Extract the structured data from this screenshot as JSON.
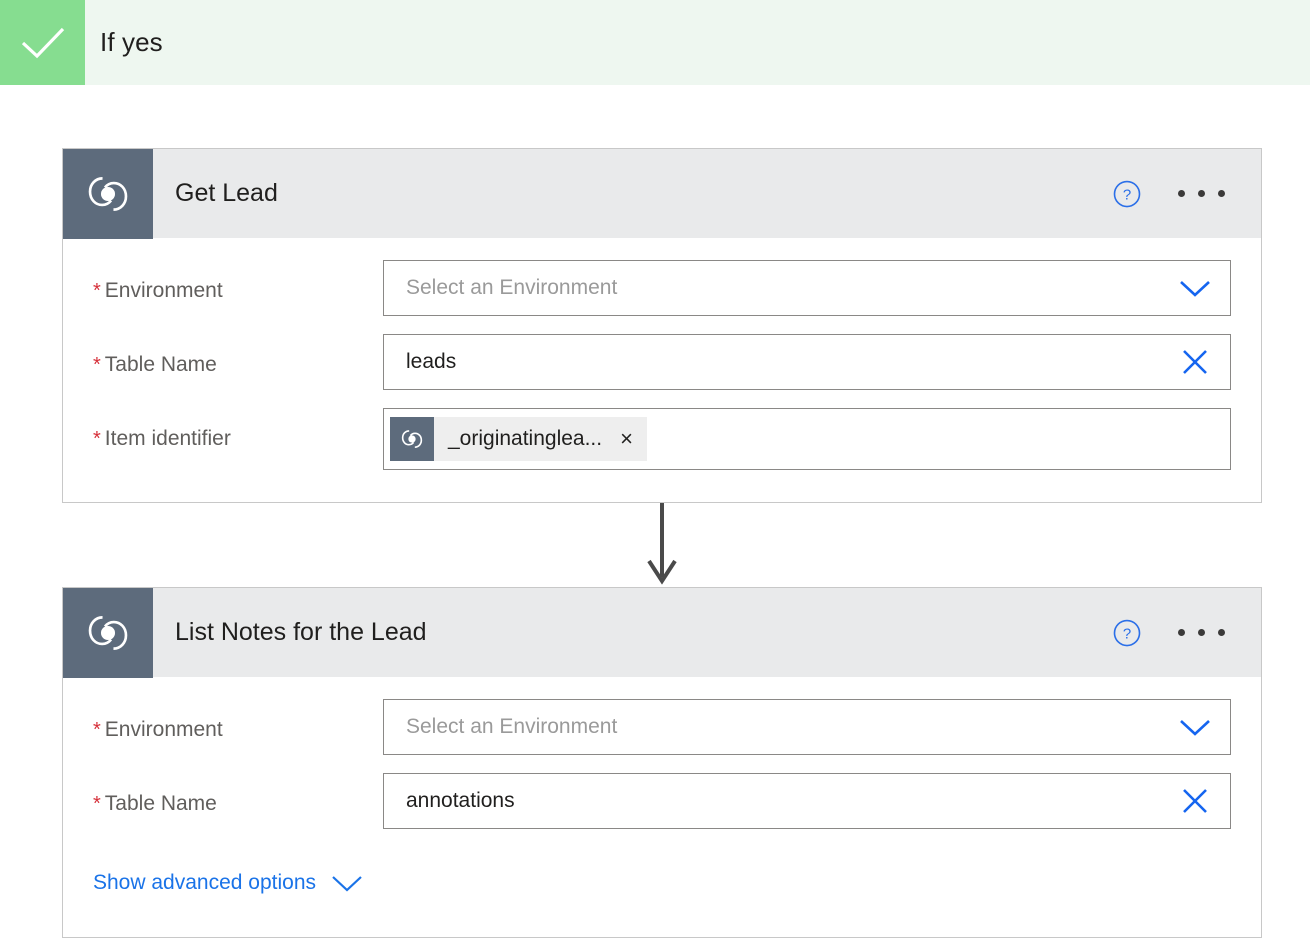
{
  "condition": {
    "label": "If yes",
    "icon": "check-icon",
    "accent_color": "#86dd90",
    "background_color": "#eef7f0"
  },
  "colors": {
    "card_header_bg": "#e9eaeb",
    "card_icon_bg": "#5d6b7c",
    "link_blue": "#1a73e8",
    "required_red": "#d6303a",
    "border_gray": "#8a8886"
  },
  "cards": [
    {
      "title": "Get Lead",
      "icon": "dataverse-icon",
      "help_icon": "help-circle-icon",
      "menu_icon": "ellipsis-icon",
      "fields": [
        {
          "label": "Environment",
          "required": true,
          "value": "",
          "placeholder": "Select an Environment",
          "action_icon": "chevron-down-icon"
        },
        {
          "label": "Table Name",
          "required": true,
          "value": "leads",
          "placeholder": "",
          "action_icon": "close-x-icon"
        },
        {
          "label": "Item identifier",
          "required": true,
          "token": {
            "label": "_originatinglea...",
            "icon": "dataverse-icon",
            "remove_icon": "close-x-icon",
            "remove_label": "×"
          }
        }
      ]
    },
    {
      "title": "List Notes for the Lead",
      "icon": "dataverse-icon",
      "help_icon": "help-circle-icon",
      "menu_icon": "ellipsis-icon",
      "fields": [
        {
          "label": "Environment",
          "required": true,
          "value": "",
          "placeholder": "Select an Environment",
          "action_icon": "chevron-down-icon"
        },
        {
          "label": "Table Name",
          "required": true,
          "value": "annotations",
          "placeholder": "",
          "action_icon": "close-x-icon"
        }
      ],
      "advanced_options": {
        "label": "Show advanced options",
        "icon": "chevron-down-icon"
      }
    }
  ],
  "connector": {
    "icon": "arrow-down-icon",
    "color": "#4a4a4a"
  }
}
